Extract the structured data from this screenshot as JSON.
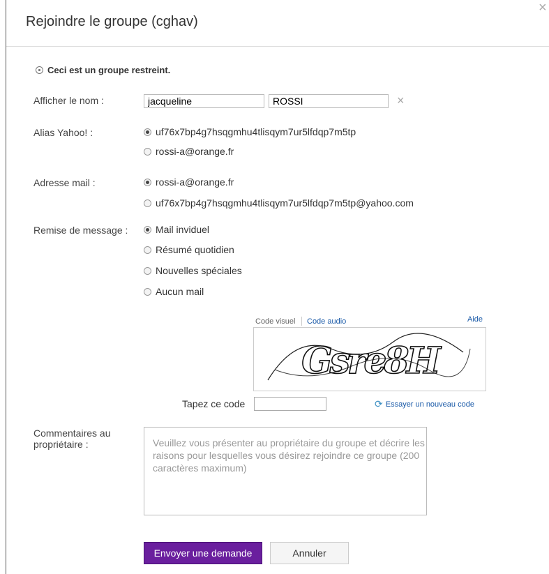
{
  "dialog": {
    "title": "Rejoindre le groupe (cghav)",
    "close_glyph": "×",
    "restricted_notice": "Ceci est un groupe restreint."
  },
  "display_name": {
    "label": "Afficher le nom :",
    "first_name": "jacqueline",
    "last_name": "ROSSI",
    "clear_glyph": "×"
  },
  "alias": {
    "label": "Alias Yahoo! :",
    "options": [
      {
        "text": "uf76x7bp4g7hsqgmhu4tlisqym7ur5lfdqp7m5tp",
        "selected": true
      },
      {
        "text": "rossi-a@orange.fr",
        "selected": false
      }
    ]
  },
  "email": {
    "label": "Adresse mail :",
    "options": [
      {
        "text": "rossi-a@orange.fr",
        "selected": true
      },
      {
        "text": "uf76x7bp4g7hsqgmhu4tlisqym7ur5lfdqp7m5tp@yahoo.com",
        "selected": false
      }
    ]
  },
  "delivery": {
    "label": "Remise de message :",
    "options": [
      {
        "text": "Mail inviduel",
        "selected": true
      },
      {
        "text": "Résumé quotidien",
        "selected": false
      },
      {
        "text": "Nouvelles spéciales",
        "selected": false
      },
      {
        "text": "Aucun mail",
        "selected": false
      }
    ]
  },
  "captcha": {
    "tab_visual": "Code visuel",
    "tab_audio": "Code audio",
    "help": "Aide",
    "image_text": "Gsre8H",
    "code_label": "Tapez ce code",
    "new_code": "Essayer un nouveau code",
    "icon": "refresh-icon"
  },
  "comments": {
    "label_line1": "Commentaires au",
    "label_line2": "propriétaire :",
    "placeholder": "Veuillez vous présenter au propriétaire du groupe et décrire les raisons pour lesquelles vous désirez rejoindre ce groupe (200 caractères maximum)"
  },
  "buttons": {
    "submit": "Envoyer une demande",
    "cancel": "Annuler"
  },
  "colors": {
    "primary": "#6a1f9e",
    "link": "#1a5aa8"
  }
}
